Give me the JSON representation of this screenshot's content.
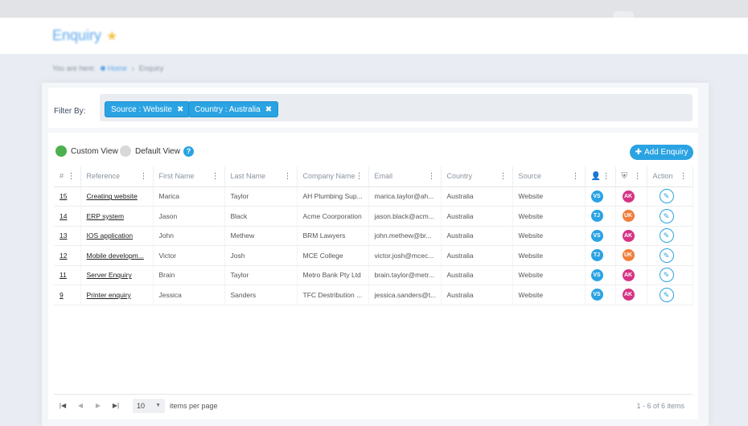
{
  "header": {
    "title": "Enquiry",
    "star_icon": "star-icon"
  },
  "breadcrumb": {
    "prefix": "You are here:",
    "home": "Home",
    "current": "Enquiry"
  },
  "filter": {
    "label": "Filter By:",
    "chips": [
      {
        "label": "Source : Website"
      },
      {
        "label": "Country : Australia"
      }
    ]
  },
  "toolbar": {
    "custom_view": "Custom View",
    "default_view": "Default View",
    "help": "?",
    "add_button": "Add Enquiry",
    "custom_color": "#4caf50",
    "default_color": "#d8d8d8"
  },
  "columns": {
    "num": "#",
    "reference": "Reference",
    "first_name": "First Name",
    "last_name": "Last Name",
    "company_name": "Company Name",
    "email": "Email",
    "country": "Country",
    "source": "Source",
    "action": "Action"
  },
  "rows": [
    {
      "num": "15",
      "reference": "Creating website",
      "first_name": "Marica",
      "last_name": "Taylor",
      "company": "AH Plumbing Sup...",
      "email": "marica.taylor@ah...",
      "country": "Australia",
      "source": "Website",
      "assignee": "VS",
      "assignee_color": "#2aa3e3",
      "owner": "AK",
      "owner_color": "#d63384"
    },
    {
      "num": "14",
      "reference": "ERP system",
      "first_name": "Jason",
      "last_name": "Black",
      "company": "Acme Coorporation",
      "email": "jason.black@acm...",
      "country": "Australia",
      "source": "Website",
      "assignee": "TJ",
      "assignee_color": "#2aa3e3",
      "owner": "UK",
      "owner_color": "#f07f3c"
    },
    {
      "num": "13",
      "reference": "IOS application",
      "first_name": "John",
      "last_name": "Methew",
      "company": "BRM Lawyers",
      "email": "john.methew@br...",
      "country": "Australia",
      "source": "Website",
      "assignee": "VS",
      "assignee_color": "#2aa3e3",
      "owner": "AK",
      "owner_color": "#d63384"
    },
    {
      "num": "12",
      "reference": "Mobile developm...",
      "first_name": "Victor",
      "last_name": "Josh",
      "company": "MCE College",
      "email": "victor.josh@mcec...",
      "country": "Australia",
      "source": "Website",
      "assignee": "TJ",
      "assignee_color": "#2aa3e3",
      "owner": "UK",
      "owner_color": "#f07f3c"
    },
    {
      "num": "11",
      "reference": "Server Enquiry",
      "first_name": "Brain",
      "last_name": "Taylor",
      "company": "Metro Bank Pty Ltd",
      "email": "brain.taylor@metr...",
      "country": "Australia",
      "source": "Website",
      "assignee": "VS",
      "assignee_color": "#2aa3e3",
      "owner": "AK",
      "owner_color": "#d63384"
    },
    {
      "num": "9",
      "reference": "Printer enquiry",
      "first_name": "Jessica",
      "last_name": "Sanders",
      "company": "TFC Destribution ...",
      "email": "jessica.sanders@t...",
      "country": "Australia",
      "source": "Website",
      "assignee": "VS",
      "assignee_color": "#2aa3e3",
      "owner": "AK",
      "owner_color": "#d63384"
    }
  ],
  "pager": {
    "page_size": "10",
    "items_label": "items per page",
    "summary": "1 - 6 of 6 items"
  }
}
